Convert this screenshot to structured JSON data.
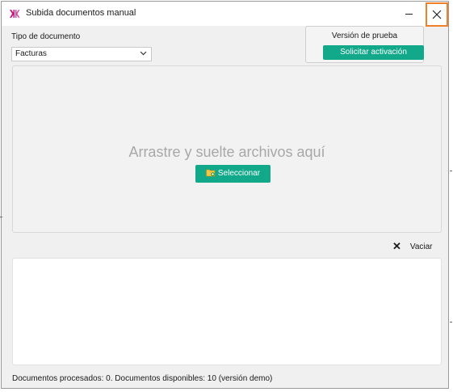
{
  "window": {
    "title": "Subida documentos manual"
  },
  "document_type": {
    "label": "Tipo de documento",
    "selected": "Facturas"
  },
  "trial": {
    "title": "Versión de prueba",
    "button": "Solicitar activación"
  },
  "dropzone": {
    "text": "Arrastre y suelte archivos aquí",
    "select_button": "Seleccionar"
  },
  "actions": {
    "clear_label": "Vaciar"
  },
  "status": {
    "text": "Documentos procesados: 0.  Documentos disponibles: 10  (versión demo)"
  },
  "colors": {
    "accent": "#12a88a",
    "close_highlight": "#f07f2a"
  },
  "icons": [
    "app-logo-icon",
    "minimize-icon",
    "close-icon",
    "chevron-down-icon",
    "folder-icon",
    "clear-x-icon"
  ]
}
